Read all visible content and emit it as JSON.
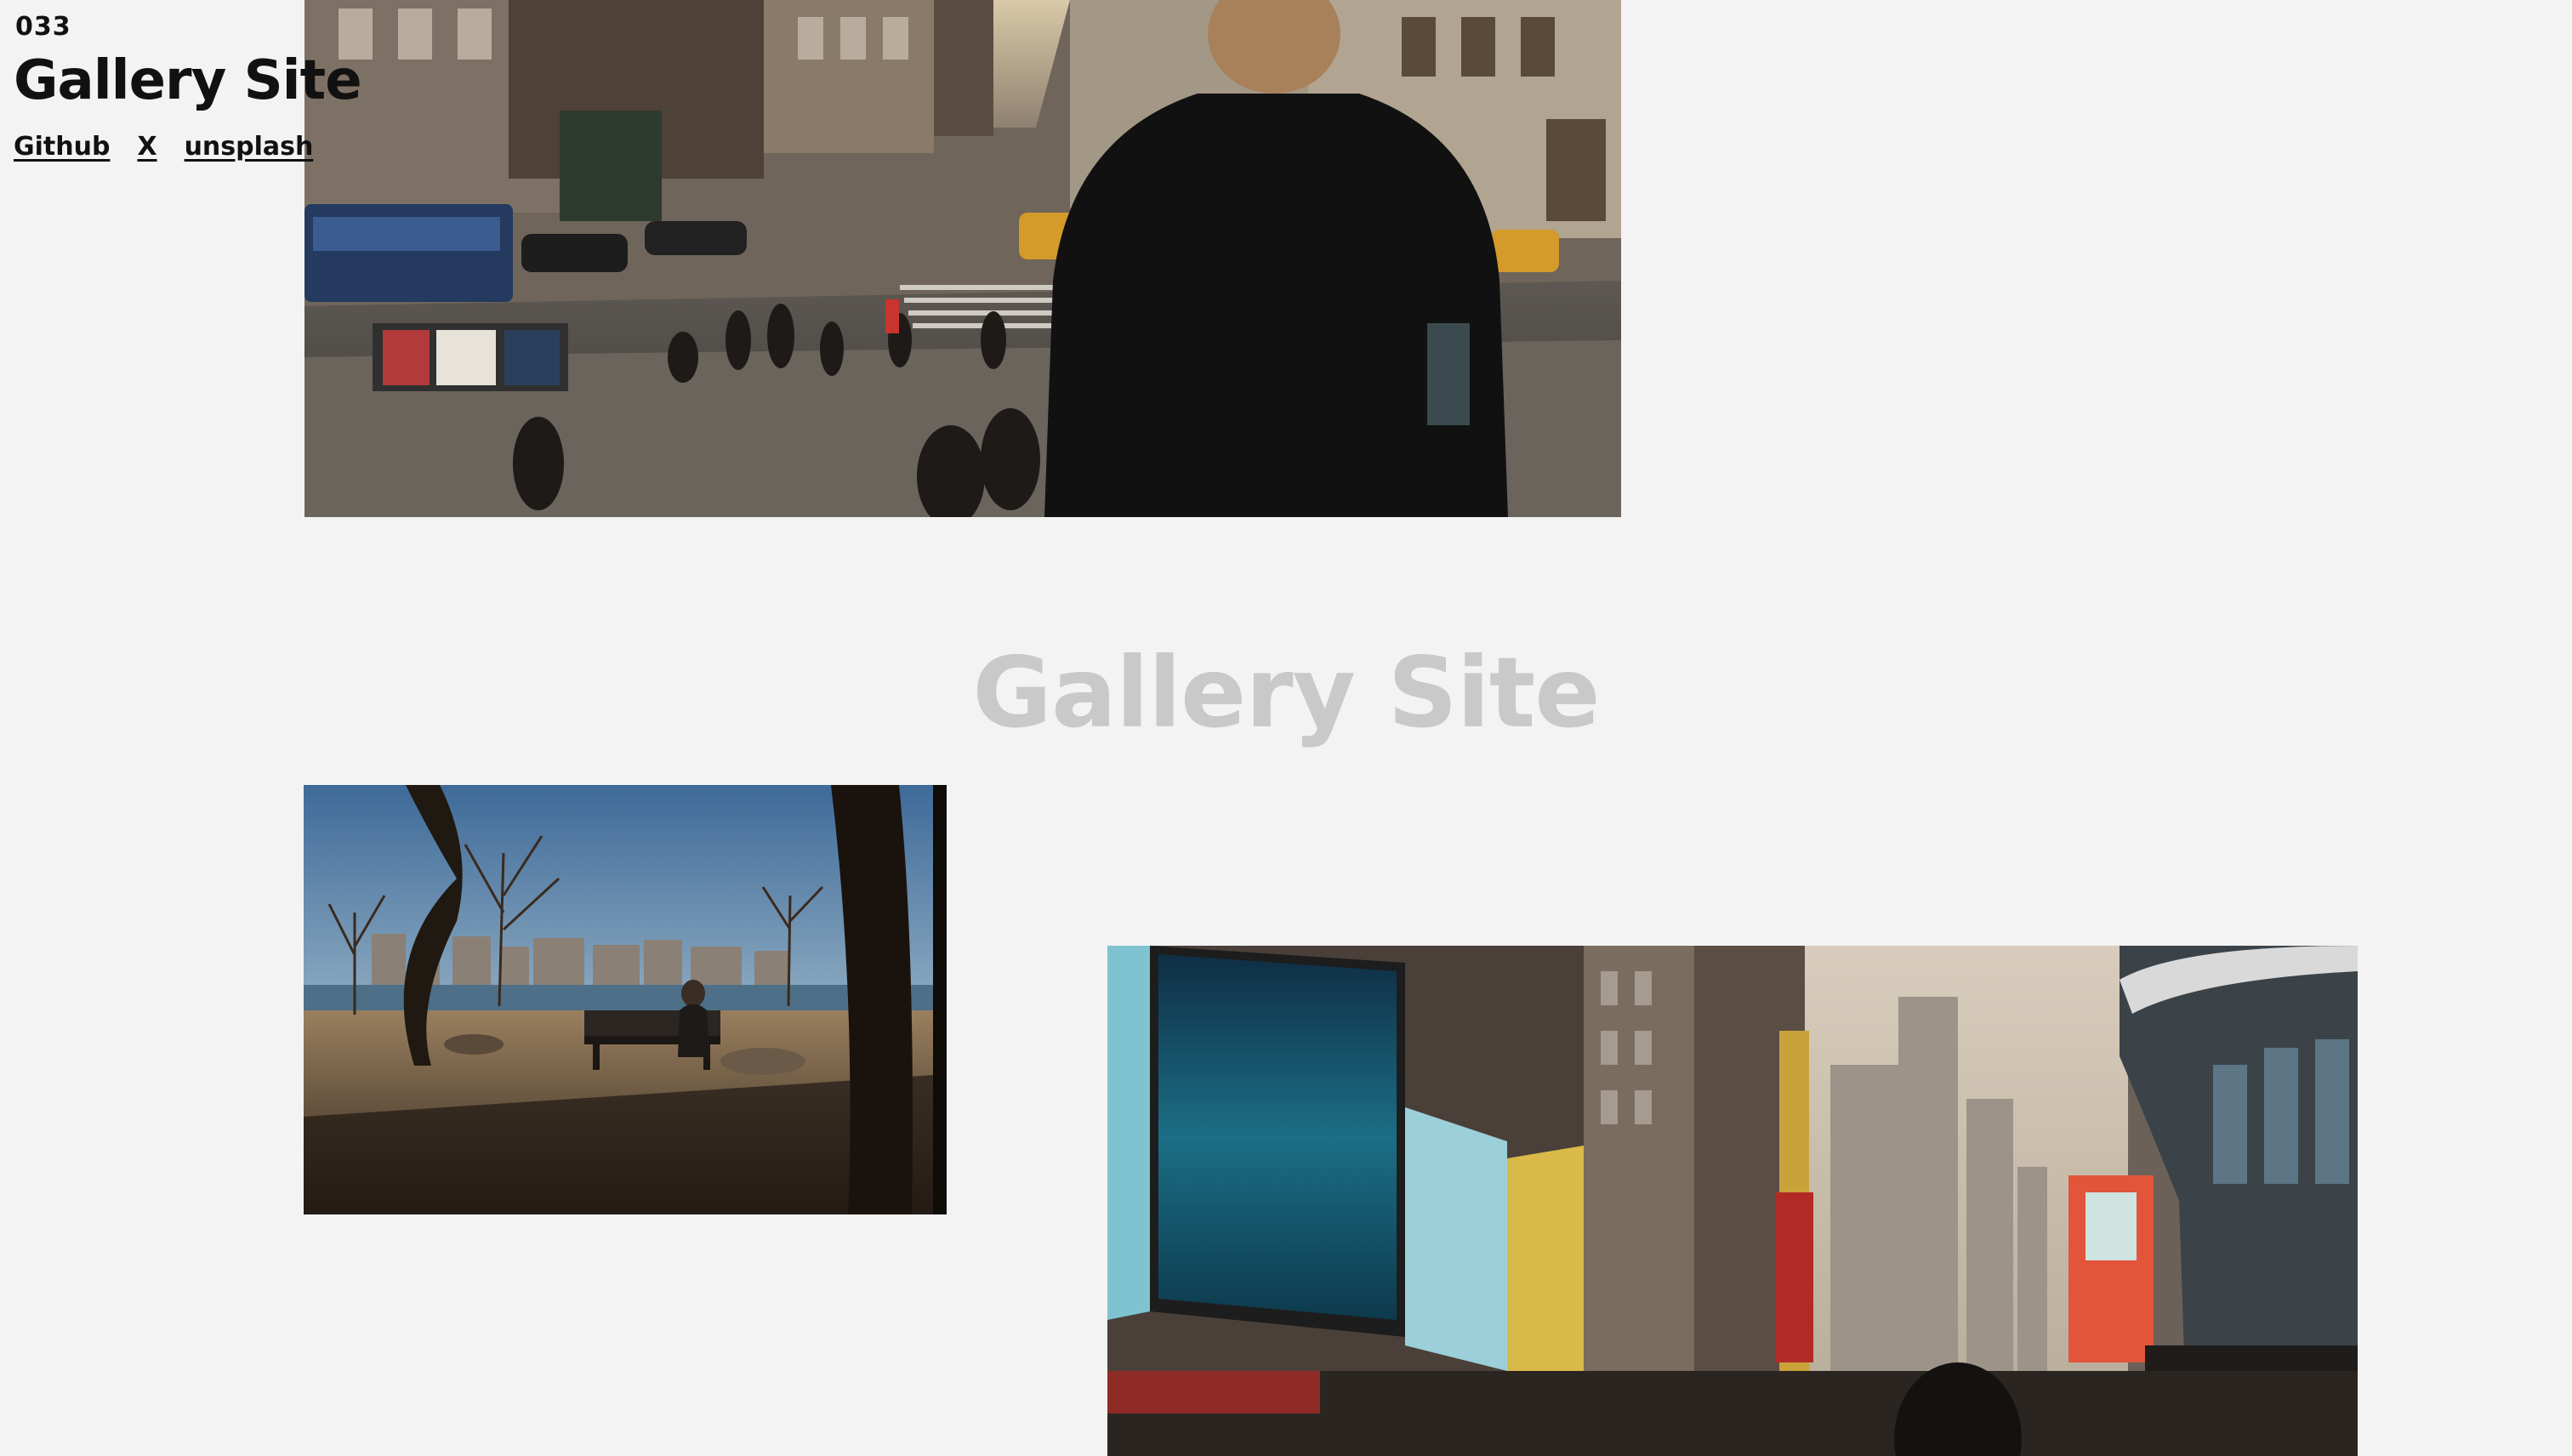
{
  "header": {
    "issue_number": "033",
    "title": "Gallery Site",
    "links": [
      {
        "label": "Github"
      },
      {
        "label": "X"
      },
      {
        "label": "unsplash"
      }
    ]
  },
  "center_title": "Gallery Site",
  "photos": [
    {
      "subject": "city-street-crowd-photo"
    },
    {
      "subject": "park-bench-waterfront-photo"
    },
    {
      "subject": "times-square-billboards-photo"
    }
  ],
  "colors": {
    "background": "#f3f3f3",
    "text": "#111111",
    "watermark": "#c9c9c9"
  }
}
